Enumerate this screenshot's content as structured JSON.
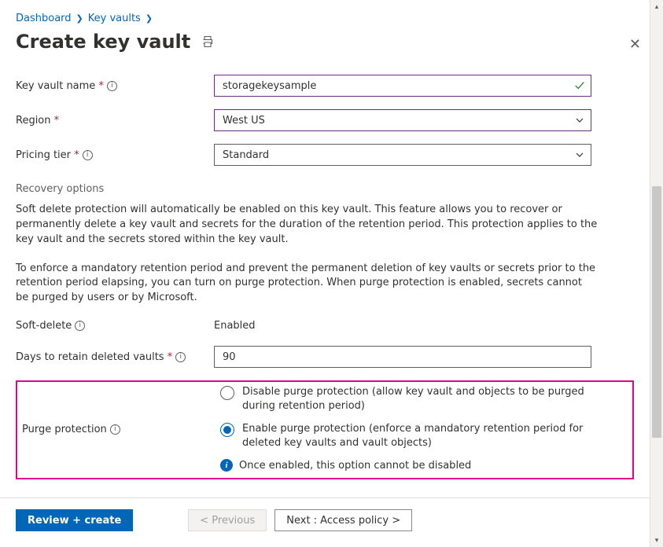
{
  "breadcrumb": {
    "items": [
      "Dashboard",
      "Key vaults"
    ]
  },
  "page": {
    "title": "Create key vault"
  },
  "form": {
    "name_label": "Key vault name *",
    "name_value": "storagekeysample",
    "region_label": "Region *",
    "region_value": "West US",
    "tier_label": "Pricing tier *",
    "tier_value": "Standard"
  },
  "recovery": {
    "heading": "Recovery options",
    "para1": "Soft delete protection will automatically be enabled on this key vault. This feature allows you to recover or permanently delete a key vault and secrets for the duration of the retention period. This protection applies to the key vault and the secrets stored within the key vault.",
    "para2": "To enforce a mandatory retention period and prevent the permanent deletion of key vaults or secrets prior to the retention period elapsing, you can turn on purge protection. When purge protection is enabled, secrets cannot be purged by users or by Microsoft.",
    "soft_delete_label": "Soft-delete",
    "soft_delete_value": "Enabled",
    "days_label": "Days to retain deleted vaults *",
    "days_value": "90",
    "purge_label": "Purge protection",
    "purge_options": [
      "Disable purge protection (allow key vault and objects to be purged during retention period)",
      "Enable purge protection (enforce a mandatory retention period for deleted key vaults and vault objects)"
    ],
    "purge_selected": 1,
    "purge_note": "Once enabled, this option cannot be disabled"
  },
  "footer": {
    "review": "Review + create",
    "previous": "< Previous",
    "next": "Next : Access policy >"
  }
}
